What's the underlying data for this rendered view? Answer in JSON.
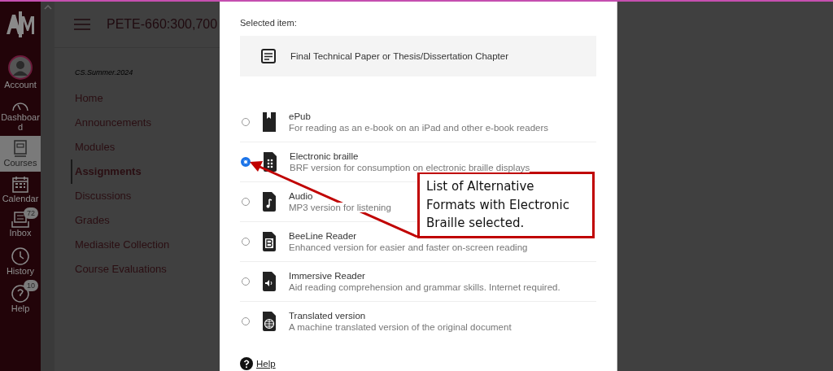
{
  "global_nav": {
    "items": [
      {
        "kind": "account",
        "label": "Account",
        "selected": false
      },
      {
        "kind": "dashboard",
        "label": "Dashboard",
        "selected": false
      },
      {
        "kind": "courses",
        "label": "Courses",
        "selected": true
      },
      {
        "kind": "calendar",
        "label": "Calendar",
        "selected": false
      },
      {
        "kind": "inbox",
        "label": "Inbox",
        "selected": false,
        "badge": "72"
      },
      {
        "kind": "history",
        "label": "History",
        "selected": false
      },
      {
        "kind": "help",
        "label": "Help",
        "selected": false,
        "badge": "10"
      }
    ]
  },
  "header": {
    "breadcrumb": "PETE-660:300,700"
  },
  "course_nav": {
    "term": "CS.Summer.2024",
    "items": [
      {
        "label": "Home",
        "selected": false
      },
      {
        "label": "Announcements",
        "selected": false
      },
      {
        "label": "Modules",
        "selected": false
      },
      {
        "label": "Assignments",
        "selected": true
      },
      {
        "label": "Discussions",
        "selected": false
      },
      {
        "label": "Grades",
        "selected": false
      },
      {
        "label": "Mediasite Collection",
        "selected": false
      },
      {
        "label": "Course Evaluations",
        "selected": false
      }
    ]
  },
  "dialog": {
    "selected_label": "Selected item:",
    "selected_item": "Final Technical Paper or Thesis/Dissertation Chapter",
    "formats": [
      {
        "kind": "book",
        "title": "ePub",
        "description": "For reading as an e-book on an iPad and other e-book readers",
        "selected": false
      },
      {
        "kind": "braille",
        "title": "Electronic braille",
        "description": "BRF version for consumption on electronic braille displays",
        "selected": true
      },
      {
        "kind": "audio",
        "title": "Audio",
        "description": "MP3 version for listening",
        "selected": false
      },
      {
        "kind": "beeline",
        "title": "BeeLine Reader",
        "description": "Enhanced version for easier and faster on-screen reading",
        "selected": false
      },
      {
        "kind": "immersive",
        "title": "Immersive Reader",
        "description": "Aid reading comprehension and grammar skills. Internet required.",
        "selected": false
      },
      {
        "kind": "globe",
        "title": "Translated version",
        "description": "A machine translated version of the original document",
        "selected": false
      }
    ],
    "help": "Help"
  },
  "annotation": {
    "text": "List of Alternative Formats with Electronic Braille selected."
  }
}
